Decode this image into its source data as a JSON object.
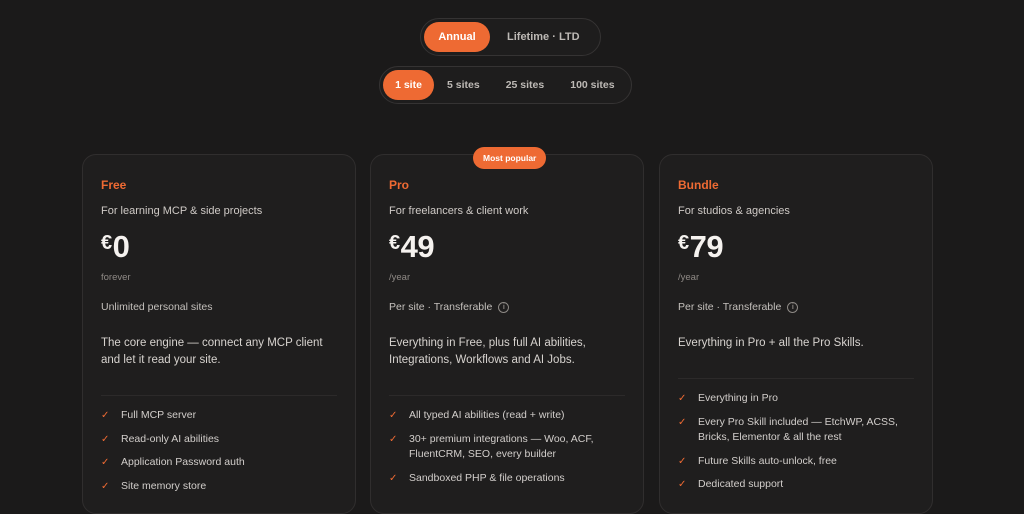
{
  "billing_toggle": {
    "annual": "Annual",
    "lifetime": "Lifetime · LTD"
  },
  "site_toggle": {
    "s1": "1 site",
    "s5": "5 sites",
    "s25": "25 sites",
    "s100": "100 sites"
  },
  "badge": "Most popular",
  "colors": {
    "accent": "#ee6a33",
    "background": "#1b1a1a",
    "card": "#1f1e1e"
  },
  "check_glyph": "✓",
  "plans": [
    {
      "name": "Free",
      "tagline": "For learning MCP & side projects",
      "currency": "€",
      "amount": "0",
      "period": "forever",
      "sites": "Unlimited personal sites",
      "description": "The core engine — connect any MCP client and let it read your site.",
      "features": [
        "Full MCP server",
        "Read-only AI abilities",
        "Application Password auth",
        "Site memory store"
      ]
    },
    {
      "name": "Pro",
      "tagline": "For freelancers & client work",
      "currency": "€",
      "amount": "49",
      "period": "/year",
      "sites": "Per site · Transferable",
      "info_glyph": "i",
      "description": "Everything in Free, plus full AI abilities, Integrations, Workflows and AI Jobs.",
      "features": [
        "All typed AI abilities (read + write)",
        "30+ premium integrations — Woo, ACF, FluentCRM, SEO, every builder",
        "Sandboxed PHP & file operations"
      ]
    },
    {
      "name": "Bundle",
      "tagline": "For studios & agencies",
      "currency": "€",
      "amount": "79",
      "period": "/year",
      "sites": "Per site · Transferable",
      "info_glyph": "i",
      "description": "Everything in Pro + all the Pro Skills.",
      "features": [
        "Everything in Pro",
        "Every Pro Skill included — EtchWP, ACSS, Bricks, Elementor & all the rest",
        "Future Skills auto-unlock, free",
        "Dedicated support"
      ]
    }
  ]
}
